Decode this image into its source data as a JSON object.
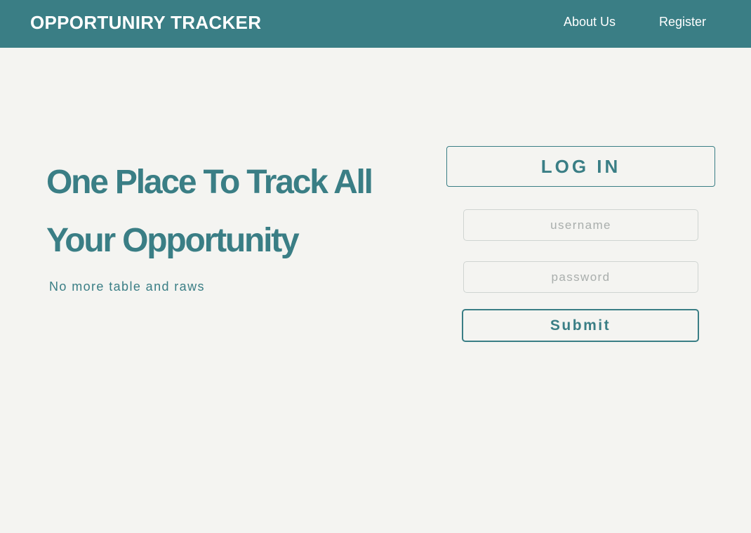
{
  "navbar": {
    "brand": "OPPORTUNIRY TRACKER",
    "links": [
      {
        "label": "About Us"
      },
      {
        "label": "Register"
      }
    ]
  },
  "hero": {
    "headline_line1": "One Place To Track All",
    "headline_line2": "Your Opportunity",
    "tagline": "No more table and raws"
  },
  "login": {
    "title": "LOG IN",
    "username": {
      "value": "",
      "placeholder": "username"
    },
    "password": {
      "value": "",
      "placeholder": "password"
    },
    "submit_label": "Submit"
  },
  "colors": {
    "accent": "#3a7e85",
    "background": "#f4f4f1",
    "nav_text": "#ffffff",
    "field_border": "#cfd4d1",
    "placeholder": "#a9aeac"
  }
}
